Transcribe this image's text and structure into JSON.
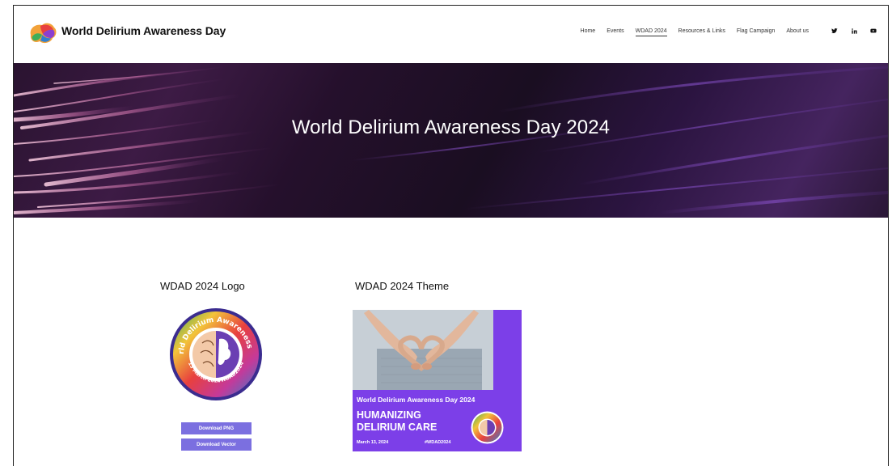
{
  "site": {
    "title": "World Delirium Awareness Day"
  },
  "nav": {
    "items": [
      {
        "label": "Home",
        "active": false
      },
      {
        "label": "Events",
        "active": false
      },
      {
        "label": "WDAD 2024",
        "active": true
      },
      {
        "label": "Resources & Links",
        "active": false
      },
      {
        "label": "Flag Campaign",
        "active": false
      },
      {
        "label": "About us",
        "active": false
      }
    ],
    "social": [
      "twitter-icon",
      "linkedin-icon",
      "youtube-icon"
    ]
  },
  "banner": {
    "title": "World Delirium Awareness Day 2024"
  },
  "logo_section": {
    "title": "WDAD 2024 Logo",
    "badge": {
      "ring_text": "World Delirium Awareness Day",
      "date_text": "13 March 2024",
      "hashtag": "#WDAD2024"
    },
    "buttons": {
      "png": "Download PNG",
      "vector": "Download Vector"
    }
  },
  "theme_section": {
    "title": "WDAD 2024 Theme",
    "poster": {
      "line1": "World Delirium Awareness Day 2024",
      "line2": "HUMANIZING DELIRIUM CARE",
      "date": "March 13, 2024",
      "hashtag": "#WDAD2024"
    }
  },
  "colors": {
    "accent_button": "#7b6fe0",
    "poster_purple": "#7c3fe8",
    "badge_ring": "#3b2c8f"
  }
}
